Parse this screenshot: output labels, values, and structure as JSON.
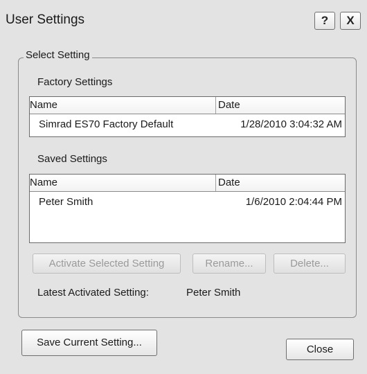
{
  "window": {
    "title": "User Settings",
    "help_label": "?",
    "close_label": "X"
  },
  "select_setting": {
    "legend": "Select Setting"
  },
  "factory_settings": {
    "label": "Factory Settings",
    "columns": [
      "Name",
      "Date"
    ],
    "rows": [
      {
        "name": "Simrad ES70 Factory Default",
        "date": "1/28/2010 3:04:32 AM"
      }
    ]
  },
  "saved_settings": {
    "label": "Saved Settings",
    "columns": [
      "Name",
      "Date"
    ],
    "rows": [
      {
        "name": "Peter Smith",
        "date": "1/6/2010 2:04:44 PM"
      }
    ]
  },
  "actions": {
    "activate_label": "Activate Selected Setting",
    "rename_label": "Rename...",
    "delete_label": "Delete..."
  },
  "status": {
    "label": "Latest Activated Setting:",
    "value": "Peter Smith"
  },
  "footer": {
    "save_label": "Save Current Setting...",
    "close_label": "Close"
  }
}
